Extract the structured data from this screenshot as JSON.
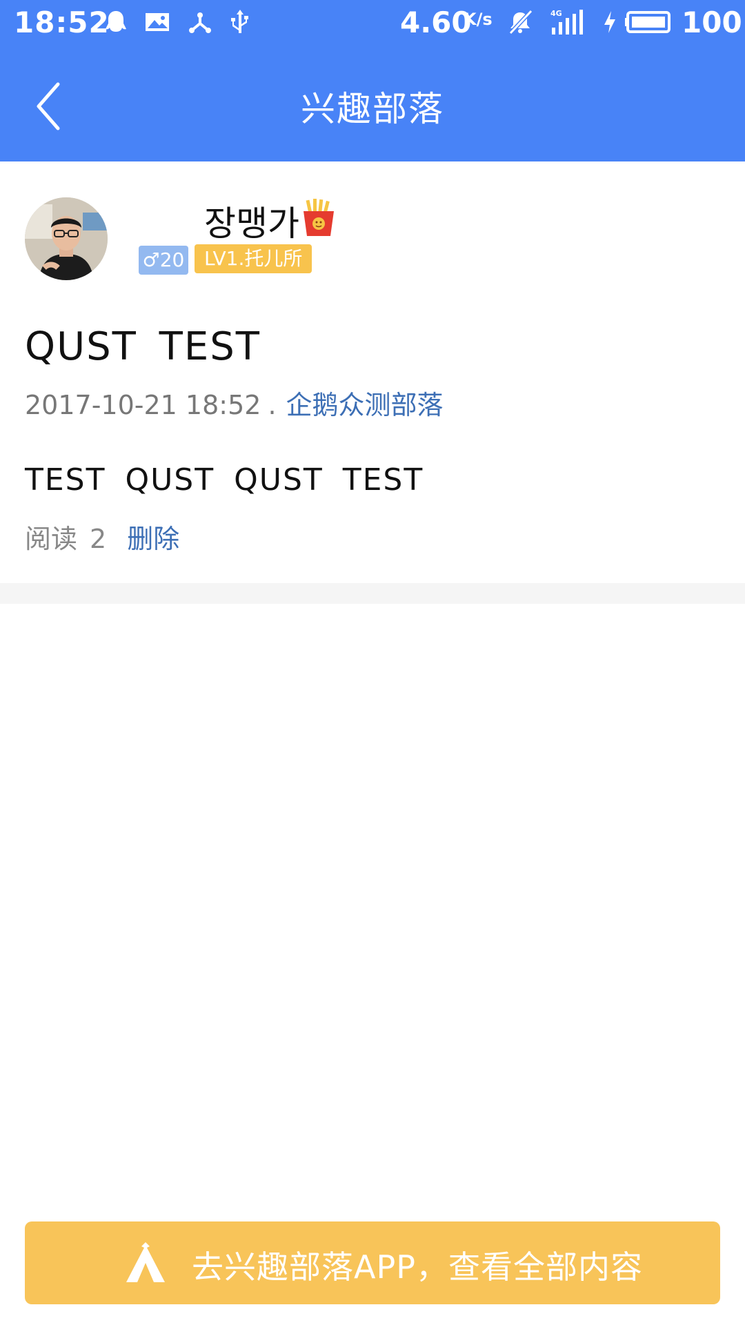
{
  "status_bar": {
    "time": "18:52",
    "network_speed": "4.60",
    "speed_unit": "K/s",
    "network_type": "4G",
    "battery": "100",
    "icons": [
      "qq-icon",
      "image-icon",
      "share-icon",
      "usb-icon",
      "mute-icon",
      "signal-icon",
      "charging-icon",
      "battery-icon"
    ]
  },
  "header": {
    "title": "兴趣部落",
    "back_icon": "chevron-left-icon"
  },
  "post": {
    "author": {
      "name": "장맹가",
      "name_emoji": "fries-icon",
      "gender_badge": "♂20",
      "level_badge": "LV1.托儿所"
    },
    "title": "QUST TEST",
    "timestamp": "2017-10-21 18:52",
    "separator": ".",
    "tribe": "企鹅众测部落",
    "content": "TEST QUST QUST TEST",
    "read_label": "阅读",
    "read_count": "2",
    "delete_label": "删除"
  },
  "banner": {
    "text": "去兴趣部落APP，查看全部内容",
    "icon": "tent-icon"
  },
  "colors": {
    "header_bg": "#4883f7",
    "link": "#3d6fb5",
    "gender_badge": "#93b9f0",
    "level_badge": "#f8c34d",
    "banner_bg": "#f8c459"
  }
}
